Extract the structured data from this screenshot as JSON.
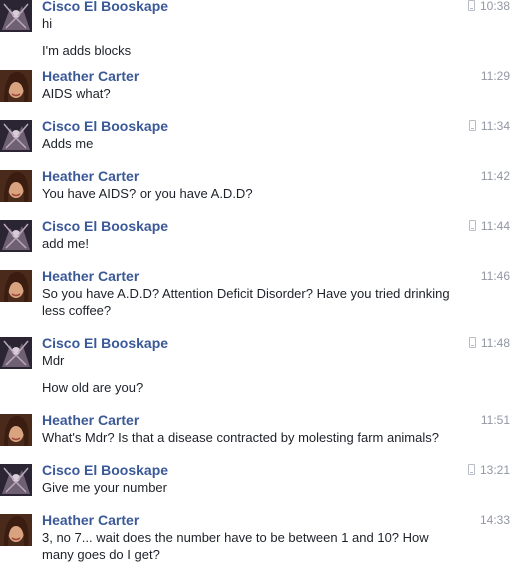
{
  "messages": [
    {
      "sender": "Cisco El Booskape",
      "time": "10:38",
      "mobile": true,
      "avatar": "cisco-avatar",
      "lines": [
        "hi",
        "I'm adds blocks"
      ]
    },
    {
      "sender": "Heather Carter",
      "time": "11:29",
      "mobile": false,
      "avatar": "heather-avatar",
      "lines": [
        "AIDS what?"
      ]
    },
    {
      "sender": "Cisco El Booskape",
      "time": "11:34",
      "mobile": true,
      "avatar": "cisco-avatar",
      "lines": [
        "Adds me"
      ]
    },
    {
      "sender": "Heather Carter",
      "time": "11:42",
      "mobile": false,
      "avatar": "heather-avatar",
      "lines": [
        "You have AIDS? or you have A.D.D?"
      ]
    },
    {
      "sender": "Cisco El Booskape",
      "time": "11:44",
      "mobile": true,
      "avatar": "cisco-avatar",
      "lines": [
        "add me!"
      ]
    },
    {
      "sender": "Heather Carter",
      "time": "11:46",
      "mobile": false,
      "avatar": "heather-avatar",
      "lines": [
        "So you have A.D.D? Attention Deficit Disorder? Have you tried drinking less coffee?"
      ]
    },
    {
      "sender": "Cisco El Booskape",
      "time": "11:48",
      "mobile": true,
      "avatar": "cisco-avatar",
      "lines": [
        "Mdr",
        "How old are you?"
      ]
    },
    {
      "sender": "Heather Carter",
      "time": "11:51",
      "mobile": false,
      "avatar": "heather-avatar",
      "lines": [
        "What's Mdr? Is that a disease contracted by molesting farm animals?"
      ]
    },
    {
      "sender": "Cisco El Booskape",
      "time": "13:21",
      "mobile": true,
      "avatar": "cisco-avatar",
      "lines": [
        "Give me your number"
      ]
    },
    {
      "sender": "Heather Carter",
      "time": "14:33",
      "mobile": false,
      "avatar": "heather-avatar",
      "lines": [
        "3, no 7... wait does the number have to be between 1 and 10? How many goes do I get?"
      ]
    }
  ],
  "colors": {
    "sender": "#3b5998",
    "text": "#1d2129",
    "timestamp": "#9197a3"
  }
}
